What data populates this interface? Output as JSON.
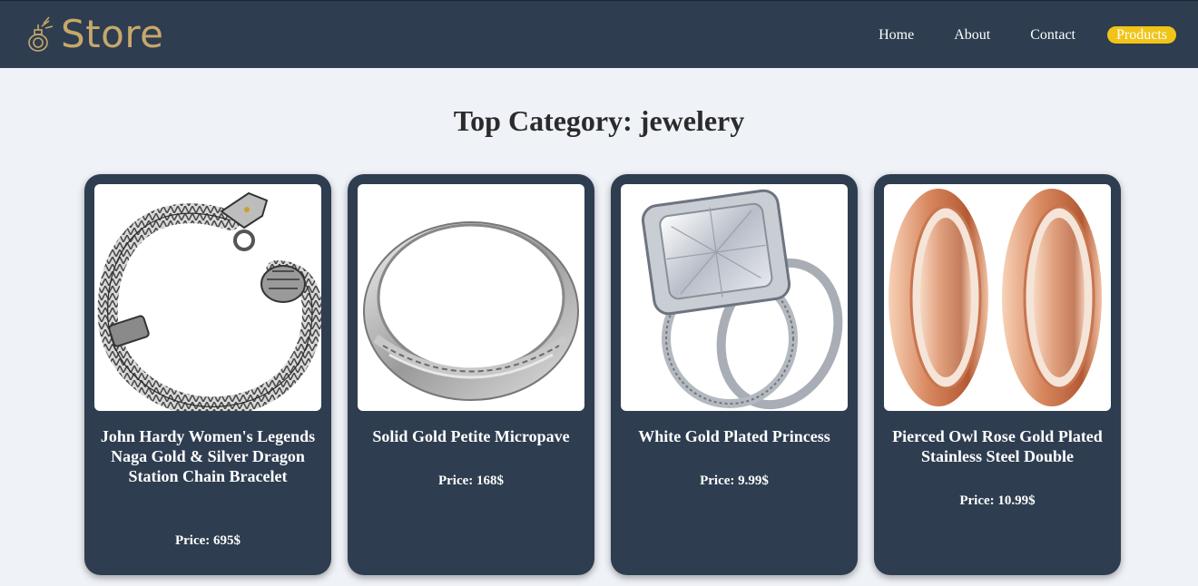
{
  "brand": {
    "name": "Store",
    "logo_icon": "perfume-bottle-icon",
    "color": "#c7a86a"
  },
  "nav": {
    "items": [
      {
        "label": "Home",
        "active": false
      },
      {
        "label": "About",
        "active": false
      },
      {
        "label": "Contact",
        "active": false
      },
      {
        "label": "Products",
        "active": true
      }
    ]
  },
  "heading": "Top Category: jewelery",
  "colors": {
    "navbar": "#2e3d50",
    "card": "#2e3d50",
    "accent": "#f0c419",
    "background": "#eff2f7"
  },
  "products": [
    {
      "title": "John Hardy Women's Legends Naga Gold & Silver Dragon Station Chain Bracelet",
      "price": "Price: 695$",
      "image": "dragon-bracelet-image"
    },
    {
      "title": "Solid Gold Petite Micropave",
      "price": "Price: 168$",
      "image": "silver-band-ring-image"
    },
    {
      "title": "White Gold Plated Princess",
      "price": "Price: 9.99$",
      "image": "diamond-ring-set-image"
    },
    {
      "title": "Pierced Owl Rose Gold Plated Stainless Steel Double",
      "price": "Price: 10.99$",
      "image": "rose-gold-plugs-image"
    }
  ]
}
